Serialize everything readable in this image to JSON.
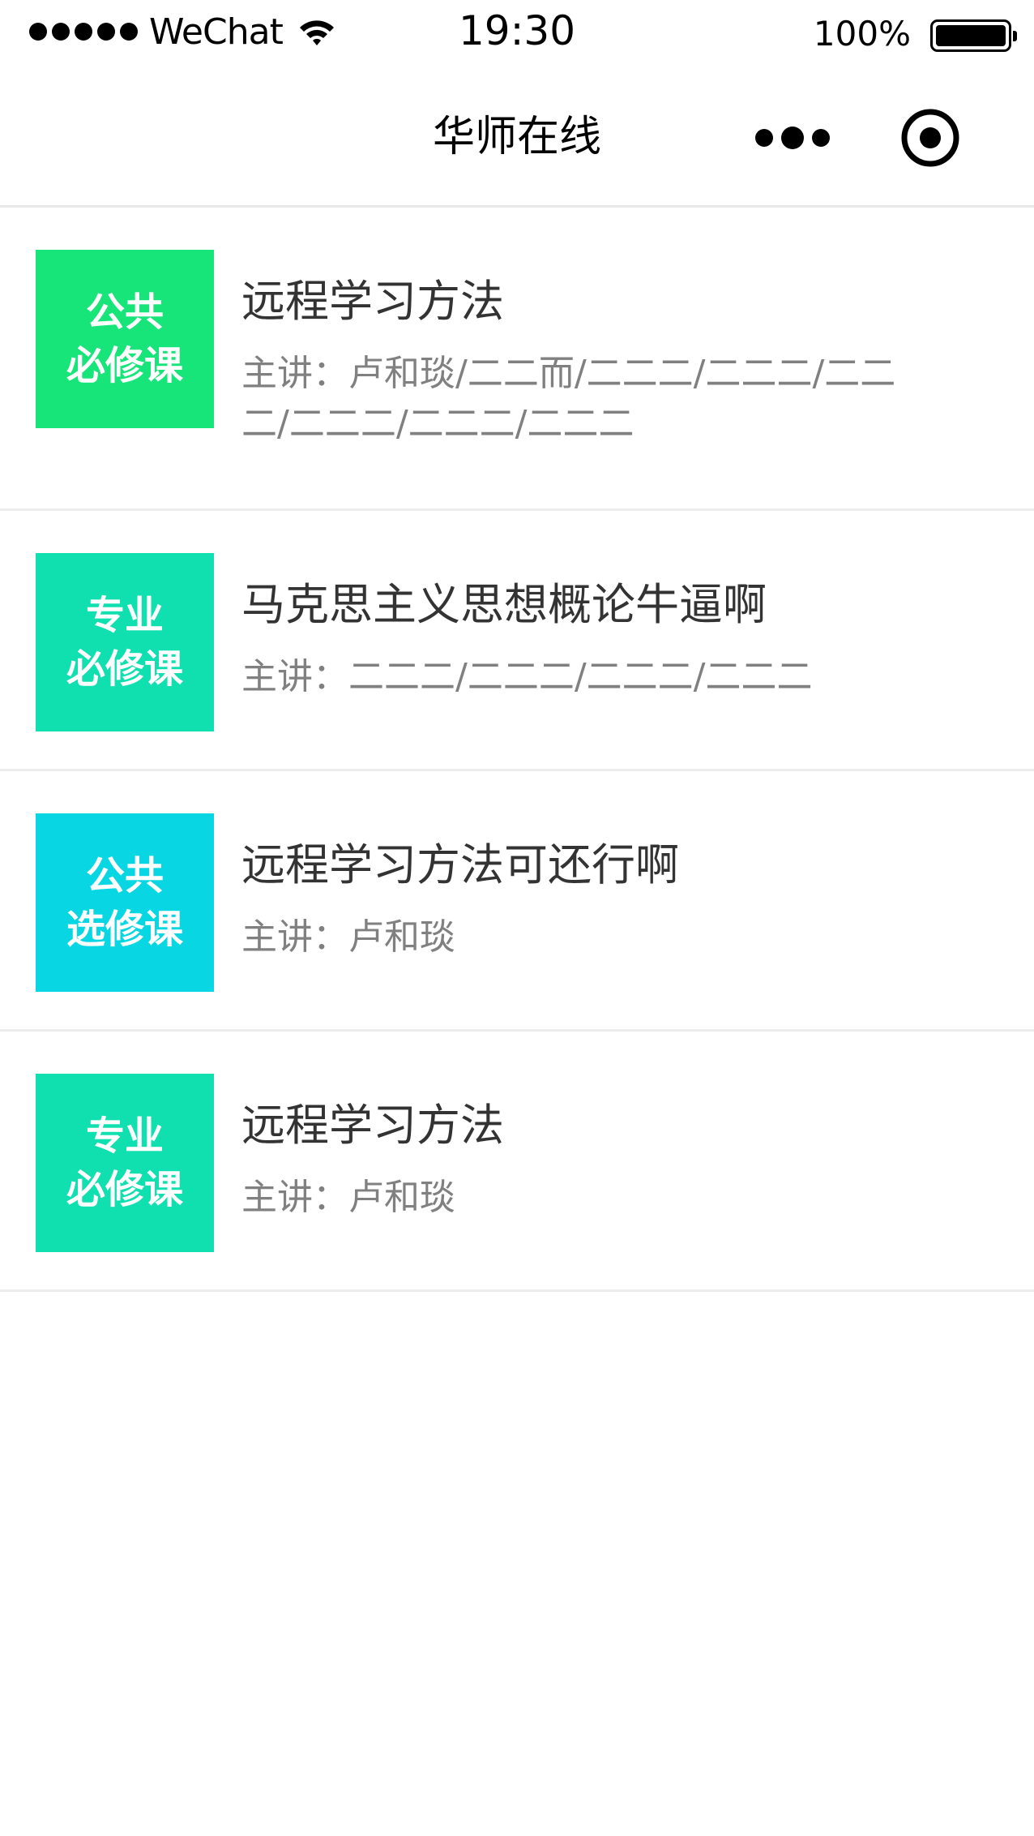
{
  "status_bar": {
    "carrier": "WeChat",
    "time": "19:30",
    "battery": "100%"
  },
  "nav": {
    "title": "华师在线"
  },
  "courses": [
    {
      "badge_line1": "公共",
      "badge_line2": "必修课",
      "badge_color": "#17e57a",
      "title": "远程学习方法",
      "teachers": "主讲：卢和琰/二二而/二二二/二二二/二二二/二二二/二二二/二二二"
    },
    {
      "badge_line1": "专业",
      "badge_line2": "必修课",
      "badge_color": "#10dfb0",
      "title": "马克思主义思想概论牛逼啊",
      "teachers": "主讲：二二二/二二二/二二二/二二二"
    },
    {
      "badge_line1": "公共",
      "badge_line2": "选修课",
      "badge_color": "#08d6e2",
      "title": "远程学习方法可还行啊",
      "teachers": "主讲：卢和琰"
    },
    {
      "badge_line1": "专业",
      "badge_line2": "必修课",
      "badge_color": "#10dfb0",
      "title": "远程学习方法",
      "teachers": "主讲：卢和琰"
    }
  ]
}
